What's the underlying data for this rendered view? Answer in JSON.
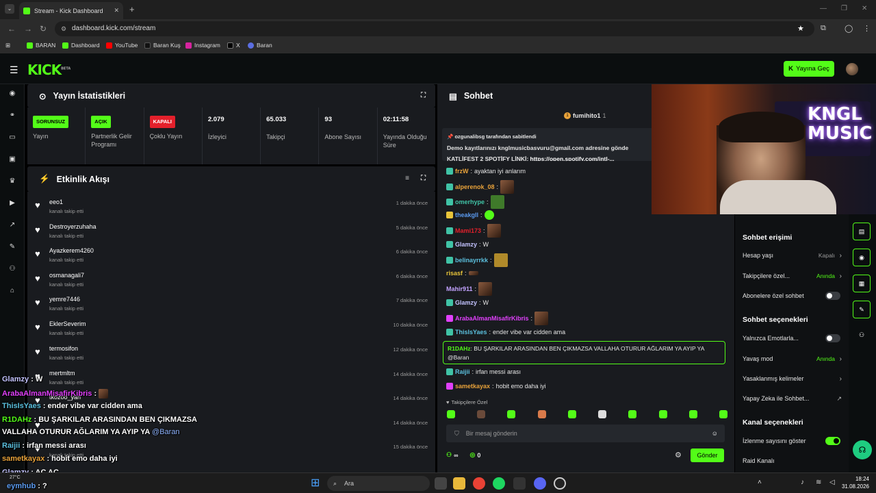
{
  "browser": {
    "tab_title": "Stream - Kick Dashboard",
    "url": "dashboard.kick.com/stream",
    "bookmarks": [
      "BARAN",
      "Dashboard",
      "YouTube",
      "Baran Kuş",
      "Instagram",
      "X",
      "Baran"
    ]
  },
  "header": {
    "logo": "KICK",
    "logo_sup": "BETA",
    "go_live": "Yayına Geç"
  },
  "stats": {
    "title": "Yayın İstatistikleri",
    "items": [
      {
        "badge": "SORUNSUZ",
        "label": "Yayın"
      },
      {
        "badge": "AÇIK",
        "label": "Partnerlik Gelir Programı"
      },
      {
        "badge": "KAPALI",
        "label": "Çoklu Yayın"
      },
      {
        "value": "2.079",
        "label": "İzleyici"
      },
      {
        "value": "65.033",
        "label": "Takipçi"
      },
      {
        "value": "93",
        "label": "Abone Sayısı"
      },
      {
        "value": "02:11:58",
        "label": "Yayında Olduğu Süre"
      }
    ]
  },
  "feed": {
    "title": "Etkinlik Akışı",
    "items": [
      {
        "name": "eeo1",
        "action": "kanalı takip etti",
        "time": "1 dakika önce"
      },
      {
        "name": "Destroyerzuhaha",
        "action": "kanalı takip etti",
        "time": "5 dakika önce"
      },
      {
        "name": "Ayazkerem4260",
        "action": "kanalı takip etti",
        "time": "6 dakika önce"
      },
      {
        "name": "osmanagali7",
        "action": "kanalı takip etti",
        "time": "6 dakika önce"
      },
      {
        "name": "yemre7446",
        "action": "kanalı takip etti",
        "time": "7 dakika önce"
      },
      {
        "name": "EklerSeverim",
        "action": "kanalı takip etti",
        "time": "10 dakika önce"
      },
      {
        "name": "termosifon",
        "action": "kanalı takip etti",
        "time": "12 dakika önce"
      },
      {
        "name": "mertmltm",
        "action": "kanalı takip etti",
        "time": "14 dakika önce"
      },
      {
        "name": "tkozoo_yan",
        "action": "",
        "time": "14 dakika önce"
      },
      {
        "name": "",
        "action": "",
        "time": "14 dakika önce"
      },
      {
        "name": "",
        "action": "kanalı takip etti",
        "time": "15 dakika önce"
      }
    ]
  },
  "chat": {
    "title": "Sohbet",
    "gifter": "fumihito1",
    "gift_count": "1",
    "pinned_by": "ozgunalibsg tarafından sabitlendi",
    "pinned_line1": "Demo kayıtlarınızı knglmusicbasvuru@gmail.com adresine gönde",
    "pinned_line2_prefix": "KATLİFEST 2 SPOTİFY LİNKİ: ",
    "pinned_link": "https://open.spotify.com/intl-...",
    "messages": [
      {
        "user": "frzW",
        "text": "ayaktan iyi anlarım",
        "color": "#e8a23a"
      },
      {
        "user": "alperenok_08",
        "text": "",
        "color": "#e8a23a"
      },
      {
        "user": "omerhype",
        "text": "",
        "color": "#40c3a6"
      },
      {
        "user": "theakgll",
        "text": "",
        "color": "#5b9bf0"
      },
      {
        "user": "Mami173",
        "text": "",
        "color": "#e3202b"
      },
      {
        "user": "Glamzy",
        "text": "W",
        "color": "#c3c3ff"
      },
      {
        "user": "belinayrrkk",
        "text": "",
        "color": "#5bc0de"
      },
      {
        "user": "risasf",
        "text": "",
        "color": "#e8c43a"
      },
      {
        "user": "Mahir911",
        "text": "",
        "color": "#c3a3ff"
      },
      {
        "user": "Glamzy",
        "text": "W",
        "color": "#c3c3ff"
      },
      {
        "user": "ArabaAlmanMisafirKibris",
        "text": "",
        "color": "#e040fb"
      },
      {
        "user": "ThisIsYaes",
        "text": "ender vibe var cidden ama",
        "color": "#5bc0de"
      },
      {
        "user": "Raijii",
        "text": "irfan messi arası",
        "color": "#5bc0de"
      },
      {
        "user": "sametkayax",
        "text": "hobit emo daha iyi",
        "color": "#e8a23a"
      }
    ],
    "highlight_user": "R1DAHz",
    "highlight_text": "BU ŞARKILAR ARASINDAN BEN ÇIKMAZSA VALLAHA OTURUR AĞLARIM YA AYIP YA @Baran",
    "followers_only": "Takipçilere Özel",
    "input_placeholder": "Bir mesaj gönderin",
    "send": "Gönder",
    "infinity": "∞",
    "points": "0"
  },
  "settings": {
    "access_title": "Sohbet erişimi",
    "account_age": "Hesap yaşı",
    "account_age_val": "Kapalı",
    "followers_only": "Takipçilere özel...",
    "followers_val": "Anında",
    "subs_only": "Abonelere özel sohbet",
    "options_title": "Sohbet seçenekleri",
    "emotes_only": "Yalnızca Emotlarla...",
    "slow_mode": "Yavaş mod",
    "slow_val": "Anında",
    "banned_words": "Yasaklanmış kelimeler",
    "ai_chat": "Yapay Zeka ile Sohbet...",
    "channel_title": "Kanal seçenekleri",
    "show_viewers": "İzlenme sayısını göster",
    "raid": "Raid Kanalı"
  },
  "overlay": [
    {
      "user": "Glamzy",
      "text": "W",
      "color": "#c3c3ff"
    },
    {
      "user": "ArabaAlmanMisafirKibris",
      "text": "",
      "color": "#e040fb"
    },
    {
      "user": "ThisIsYaes",
      "text": "ender vibe var cidden ama",
      "color": "#5bc0de"
    },
    {
      "user": "R1DAHz",
      "text": "BU ŞARKILAR ARASINDAN BEN ÇIKMAZSA",
      "color": "#53fc18"
    },
    {
      "user": "",
      "text": "VALLAHA OTURUR AĞLARIM YA AYIP YA",
      "color": "#fff",
      "mention": "@Baran"
    },
    {
      "user": "Raijii",
      "text": "irfan messi arası",
      "color": "#5bc0de"
    },
    {
      "user": "sametkayax",
      "text": "hobit emo daha iyi",
      "color": "#e8a23a"
    },
    {
      "user": "Glamzy",
      "text": "AÇ AÇ",
      "color": "#c3c3ff"
    },
    {
      "user": "eymhub",
      "text": "?",
      "color": "#5b9bf0"
    }
  ],
  "video": {
    "sign": "KNGL MUSIC"
  },
  "taskbar": {
    "search": "Ara",
    "temp": "27°C",
    "time": "18:24",
    "date": "31.08.2026"
  }
}
